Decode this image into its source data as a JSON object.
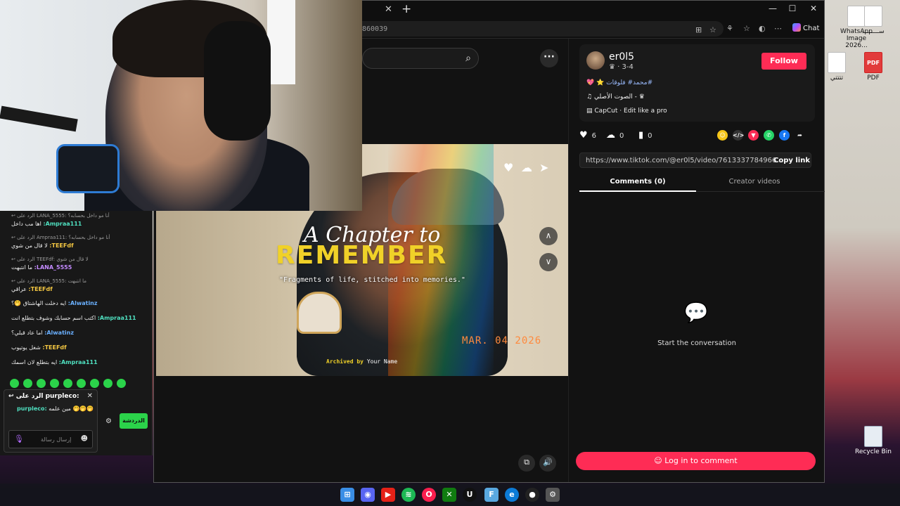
{
  "desktop": {
    "icons": [
      {
        "label": "WhatsApp\nImage 2026...",
        "kind": "img"
      },
      {
        "label": "ســـــــــ",
        "kind": "doc"
      },
      {
        "label": "تتتتي",
        "kind": "doc"
      },
      {
        "label": "PDF",
        "kind": "pdf"
      },
      {
        "label": "Recycle Bin",
        "kind": "bin"
      }
    ]
  },
  "browser": {
    "url_fragment": "860039",
    "chat_label": "Chat",
    "win_controls": [
      "—",
      "☐",
      "✕"
    ]
  },
  "video": {
    "title_line1": "A Chapter to",
    "title_line2": "REMEMBER",
    "subtitle": "\"Fragments of life, stitched into memories.\"",
    "date": "MAR. 04 2026",
    "archived_prefix": "Archived by",
    "archived_name": "Your Name"
  },
  "author": {
    "username": "er0l5",
    "sub": "· 3-4",
    "follow_label": "Follow",
    "desc_tags": "محمد# فلوقات#",
    "music": "الصوت الأصلي -",
    "capcut": "CapCut · Edit like a pro"
  },
  "stats": {
    "likes": "6",
    "comments": "0",
    "saves": "0"
  },
  "link": {
    "url": "https://www.tiktok.com/@er0l5/video/7613337784966...",
    "copy_label": "Copy link"
  },
  "tabs": {
    "comments": "Comments (0)",
    "creator_videos": "Creator videos"
  },
  "empty_state": "Start the conversation",
  "login_label": "Log in to comment",
  "chat": {
    "messages": [
      {
        "reply": "↩ الرد على LANA_5555: أنا مو داخل بحسابه؟",
        "user": "Ampraa111:",
        "text": "اها مب داخل",
        "color": "#4fe0c0"
      },
      {
        "reply": "↩ الرد على Ampraa111: أنا مو داخل بحسابه؟",
        "user": "TEEFdf:",
        "text": "لا قال من شوي",
        "color": "#f5c842"
      },
      {
        "reply": "↩ الرد على TEEFdf: لا قال من شوي",
        "user": "LANA_5555:",
        "text": "ما انتبهت",
        "color": "#c48bff"
      },
      {
        "reply": "↩ الرد على LANA_5555: ما انتبهت",
        "user": "TEEFdf:",
        "text": "عراقي",
        "color": "#f5c842"
      },
      {
        "reply": "",
        "user": "Alwatinz:",
        "text": "ايه دخلت الهاشتاق 🤭؟",
        "color": "#6ab0ff"
      },
      {
        "reply": "",
        "user": "Ampraa111:",
        "text": "اكتب اسم حسابك وشوف بتطلع انت",
        "color": "#4fe0c0"
      },
      {
        "reply": "",
        "user": "Alwatinz:",
        "text": "اما عاد قبلي؟",
        "color": "#6ab0ff"
      },
      {
        "reply": "",
        "user": "TEEFdf:",
        "text": "شغل يوتيوب",
        "color": "#f5c842"
      },
      {
        "reply": "",
        "user": "Ampraa111:",
        "text": "ايه بتطلع لان اسمك",
        "color": "#4fe0c0"
      }
    ],
    "reply_to_label": "الرد على purpleco:",
    "reply_preview_user": "purpleco:",
    "reply_preview_text": "مين علمه 🤭🤭🤭",
    "input_placeholder": "إرسال رسالة",
    "send_label": "الدردشة"
  }
}
